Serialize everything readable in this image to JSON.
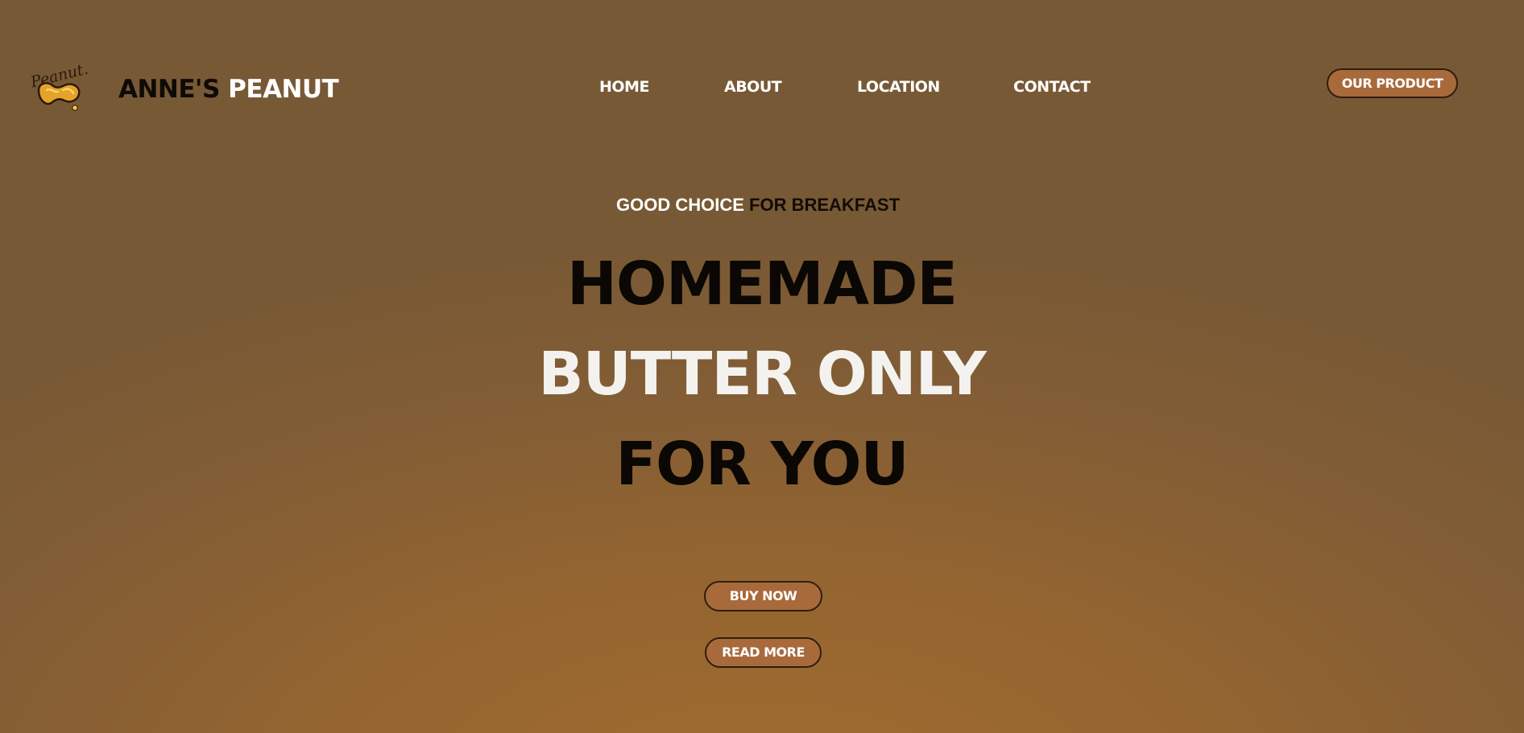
{
  "brand": {
    "logo_text": "Peanut.",
    "name_part1": "ANNE'S",
    "name_part2": "PEANUT"
  },
  "nav": {
    "items": [
      {
        "label": "HOME"
      },
      {
        "label": "ABOUT"
      },
      {
        "label": "LOCATION"
      },
      {
        "label": "CONTACT"
      }
    ],
    "cta_label": "OUR PRODUCT"
  },
  "hero": {
    "tagline_part1": "GOOD CHOICE",
    "tagline_part2": "FOR BREAKFAST",
    "line1": "HOMEMADE",
    "line2": "BUTTER ONLY",
    "line3": "FOR YOU",
    "buy_label": "BUY NOW",
    "read_label": "READ MORE"
  },
  "colors": {
    "background": "#946530",
    "button": "#a86a3a",
    "text_dark": "#0a0704",
    "text_light": "#ffffff"
  },
  "icons": {
    "logo": "peanut-logo-icon"
  }
}
